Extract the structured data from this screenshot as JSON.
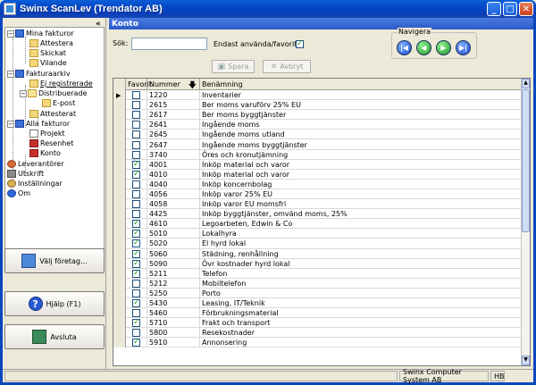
{
  "window": {
    "title": "Swinx ScanLev (Trendator AB)",
    "minimize": "_",
    "maximize": "□",
    "close": "✕"
  },
  "sidebar": {
    "collapse": "«",
    "tree": {
      "mina_fakturor": "Mina fakturor",
      "attestera": "Attestera",
      "skickat": "Skickat",
      "vilande": "Vilande",
      "fakturaarkiv": "Fakturaarkiv",
      "ej_registrerade": "Ej registrerade",
      "distribuerade": "Distribuerade",
      "e_post": "E-post",
      "attesterat": "Attesterat",
      "alla_fakturor": "Alla fakturor",
      "projekt": "Projekt",
      "resenhet": "Resenhet",
      "konto": "Konto",
      "leverantorer": "Leverantörer",
      "utskrift": "Utskrift",
      "installningar": "Inställningar",
      "om": "Om"
    },
    "buttons": {
      "valj_foretag": "Välj företag...",
      "hjalp": "Hjälp (F1)",
      "avsluta": "Avsluta"
    }
  },
  "main": {
    "header": "Konto",
    "search_label": "Sök:",
    "search_value": "",
    "only_used_label": "Endast använda/favoriter",
    "only_used_checked": true,
    "navigate_label": "Navigera",
    "save_label": "Spara",
    "cancel_label": "Avbryt",
    "columns": {
      "favorit": "Favorit",
      "nummer": "Nummer",
      "benamning": "Benämning"
    },
    "rows": [
      {
        "fav": false,
        "num": "1220",
        "name": "Inventarier"
      },
      {
        "fav": false,
        "num": "2615",
        "name": "Ber moms varuförv 25% EU"
      },
      {
        "fav": false,
        "num": "2617",
        "name": "Ber moms byggtjänster"
      },
      {
        "fav": false,
        "num": "2641",
        "name": "Ingående moms"
      },
      {
        "fav": false,
        "num": "2645",
        "name": "Ingående moms utland"
      },
      {
        "fav": false,
        "num": "2647",
        "name": "Ingående moms byggtjänster"
      },
      {
        "fav": false,
        "num": "3740",
        "name": "Öres och kronutjämning"
      },
      {
        "fav": true,
        "num": "4001",
        "name": "Inköp material och varor"
      },
      {
        "fav": true,
        "num": "4010",
        "name": "Inköp material och varor"
      },
      {
        "fav": false,
        "num": "4040",
        "name": "Inköp koncernbolag"
      },
      {
        "fav": false,
        "num": "4056",
        "name": "Inköp varor 25% EU"
      },
      {
        "fav": false,
        "num": "4058",
        "name": "Inköp varor EU momsfri"
      },
      {
        "fav": false,
        "num": "4425",
        "name": "Inköp byggtjänster, omvänd moms, 25%"
      },
      {
        "fav": true,
        "num": "4610",
        "name": "Legoarbeten, Edwin & Co"
      },
      {
        "fav": true,
        "num": "5010",
        "name": "Lokalhyra"
      },
      {
        "fav": true,
        "num": "5020",
        "name": "El hyrd lokal"
      },
      {
        "fav": true,
        "num": "5060",
        "name": "Städning, renhållning"
      },
      {
        "fav": true,
        "num": "5090",
        "name": "Övr kostnader hyrd lokal"
      },
      {
        "fav": true,
        "num": "5211",
        "name": "Telefon"
      },
      {
        "fav": false,
        "num": "5212",
        "name": "Mobiltelefon"
      },
      {
        "fav": false,
        "num": "5250",
        "name": "Porto"
      },
      {
        "fav": true,
        "num": "5430",
        "name": "Leasing, IT/Teknik"
      },
      {
        "fav": false,
        "num": "5460",
        "name": "Förbrukningsmaterial"
      },
      {
        "fav": true,
        "num": "5710",
        "name": "Frakt och transport"
      },
      {
        "fav": false,
        "num": "5800",
        "name": "Resekostnader"
      },
      {
        "fav": true,
        "num": "5910",
        "name": "Annonsering"
      }
    ]
  },
  "statusbar": {
    "company": "Swinx Computer System AB",
    "user": "HB"
  }
}
